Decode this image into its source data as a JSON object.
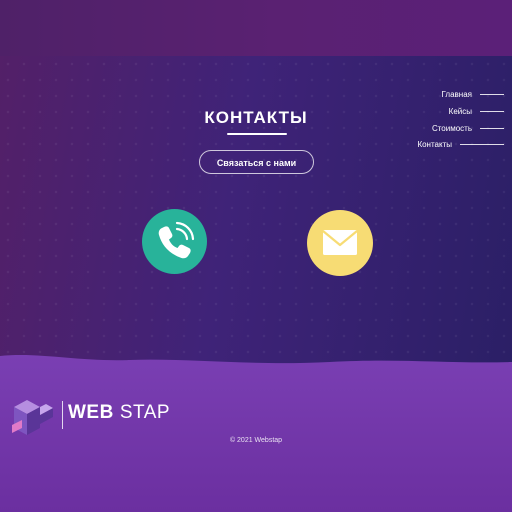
{
  "colors": {
    "hero_left": "#532068",
    "hero_right": "#2b1f66",
    "footer": "#7a40b0",
    "phone_circle": "#28b39a",
    "mail_circle": "#f7dc74",
    "text": "#ffffff"
  },
  "nav": {
    "items": [
      {
        "label": "Главная"
      },
      {
        "label": "Кейсы"
      },
      {
        "label": "Стоимость"
      },
      {
        "label": "Контакты"
      }
    ]
  },
  "page": {
    "title": "КОНТАКТЫ",
    "cta_label": "Связаться с нами"
  },
  "contacts": {
    "phone_icon": "phone-icon",
    "mail_icon": "envelope-icon"
  },
  "footer": {
    "logo_bold": "WEB",
    "logo_light": "STAP",
    "copyright": "© 2021 Webstap"
  }
}
